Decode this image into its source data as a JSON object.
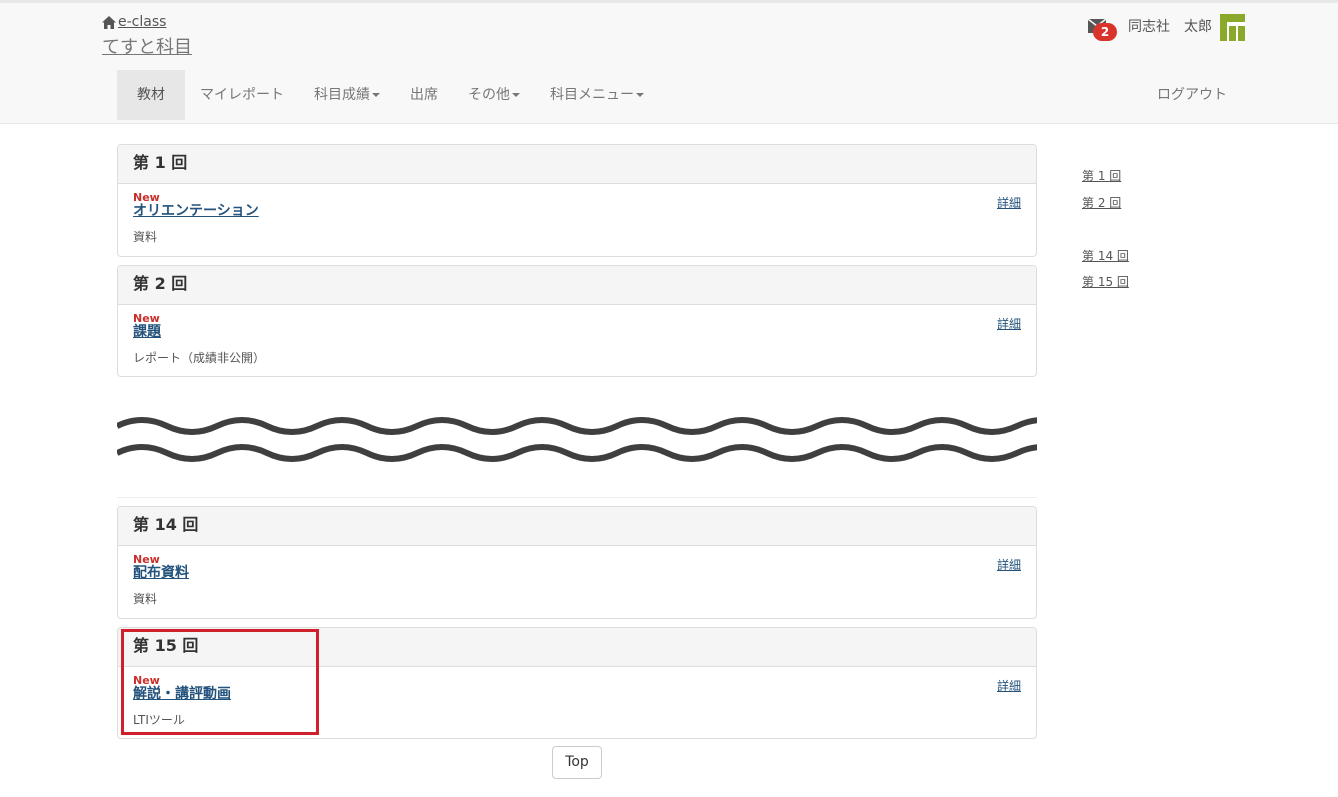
{
  "header": {
    "site_name": "e-class",
    "course_title": "てすと科目",
    "mail_count": "2",
    "user_org": "同志社",
    "user_name": "太郎"
  },
  "nav": {
    "items": [
      {
        "label": "教材",
        "active": true,
        "dropdown": false
      },
      {
        "label": "マイレポート",
        "active": false,
        "dropdown": false
      },
      {
        "label": "科目成績",
        "active": false,
        "dropdown": true
      },
      {
        "label": "出席",
        "active": false,
        "dropdown": false
      },
      {
        "label": "その他",
        "active": false,
        "dropdown": true
      },
      {
        "label": "科目メニュー",
        "active": false,
        "dropdown": true
      }
    ],
    "logout": "ログアウト"
  },
  "sessions": [
    {
      "heading": "第 1 回",
      "new_label": "New",
      "title": "オリエンテーション",
      "type": "資料",
      "detail": "詳細"
    },
    {
      "heading": "第 2 回",
      "new_label": "New",
      "title": "課題",
      "type": "レポート（成績非公開）",
      "detail": "詳細"
    },
    {
      "heading": "第 14 回",
      "new_label": "New",
      "title": "配布資料",
      "type": "資料",
      "detail": "詳細"
    },
    {
      "heading": "第 15 回",
      "new_label": "New",
      "title": "解説・講評動画",
      "type": "LTIツール",
      "detail": "詳細"
    }
  ],
  "sidenav": [
    "第 1 回",
    "第 2 回",
    "第 14 回",
    "第 15 回"
  ],
  "top_button": "Top",
  "colors": {
    "accent_link": "#23527c",
    "new_label": "#c9302c",
    "badge": "#d9342b",
    "highlight": "#d0202b",
    "avatar": "#8aa829"
  },
  "icons": [
    "home-icon",
    "mail-icon",
    "avatar-icon",
    "caret-down-icon"
  ]
}
